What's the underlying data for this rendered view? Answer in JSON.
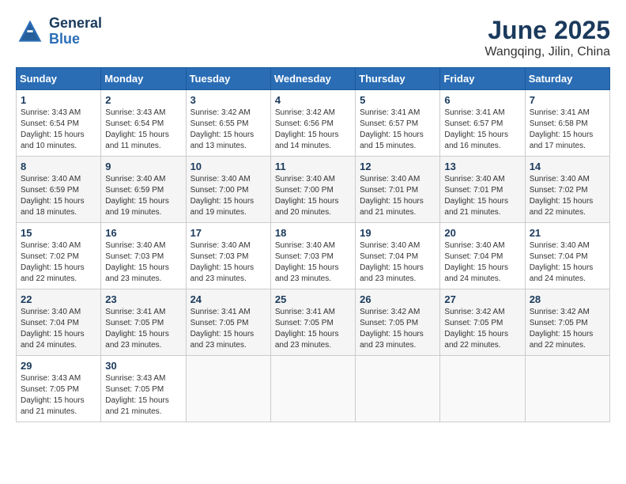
{
  "logo": {
    "line1": "General",
    "line2": "Blue"
  },
  "title": "June 2025",
  "subtitle": "Wangqing, Jilin, China",
  "days_of_week": [
    "Sunday",
    "Monday",
    "Tuesday",
    "Wednesday",
    "Thursday",
    "Friday",
    "Saturday"
  ],
  "weeks": [
    [
      {
        "day": "1",
        "info": "Sunrise: 3:43 AM\nSunset: 6:54 PM\nDaylight: 15 hours\nand 10 minutes."
      },
      {
        "day": "2",
        "info": "Sunrise: 3:43 AM\nSunset: 6:54 PM\nDaylight: 15 hours\nand 11 minutes."
      },
      {
        "day": "3",
        "info": "Sunrise: 3:42 AM\nSunset: 6:55 PM\nDaylight: 15 hours\nand 13 minutes."
      },
      {
        "day": "4",
        "info": "Sunrise: 3:42 AM\nSunset: 6:56 PM\nDaylight: 15 hours\nand 14 minutes."
      },
      {
        "day": "5",
        "info": "Sunrise: 3:41 AM\nSunset: 6:57 PM\nDaylight: 15 hours\nand 15 minutes."
      },
      {
        "day": "6",
        "info": "Sunrise: 3:41 AM\nSunset: 6:57 PM\nDaylight: 15 hours\nand 16 minutes."
      },
      {
        "day": "7",
        "info": "Sunrise: 3:41 AM\nSunset: 6:58 PM\nDaylight: 15 hours\nand 17 minutes."
      }
    ],
    [
      {
        "day": "8",
        "info": "Sunrise: 3:40 AM\nSunset: 6:59 PM\nDaylight: 15 hours\nand 18 minutes."
      },
      {
        "day": "9",
        "info": "Sunrise: 3:40 AM\nSunset: 6:59 PM\nDaylight: 15 hours\nand 19 minutes."
      },
      {
        "day": "10",
        "info": "Sunrise: 3:40 AM\nSunset: 7:00 PM\nDaylight: 15 hours\nand 19 minutes."
      },
      {
        "day": "11",
        "info": "Sunrise: 3:40 AM\nSunset: 7:00 PM\nDaylight: 15 hours\nand 20 minutes."
      },
      {
        "day": "12",
        "info": "Sunrise: 3:40 AM\nSunset: 7:01 PM\nDaylight: 15 hours\nand 21 minutes."
      },
      {
        "day": "13",
        "info": "Sunrise: 3:40 AM\nSunset: 7:01 PM\nDaylight: 15 hours\nand 21 minutes."
      },
      {
        "day": "14",
        "info": "Sunrise: 3:40 AM\nSunset: 7:02 PM\nDaylight: 15 hours\nand 22 minutes."
      }
    ],
    [
      {
        "day": "15",
        "info": "Sunrise: 3:40 AM\nSunset: 7:02 PM\nDaylight: 15 hours\nand 22 minutes."
      },
      {
        "day": "16",
        "info": "Sunrise: 3:40 AM\nSunset: 7:03 PM\nDaylight: 15 hours\nand 23 minutes."
      },
      {
        "day": "17",
        "info": "Sunrise: 3:40 AM\nSunset: 7:03 PM\nDaylight: 15 hours\nand 23 minutes."
      },
      {
        "day": "18",
        "info": "Sunrise: 3:40 AM\nSunset: 7:03 PM\nDaylight: 15 hours\nand 23 minutes."
      },
      {
        "day": "19",
        "info": "Sunrise: 3:40 AM\nSunset: 7:04 PM\nDaylight: 15 hours\nand 23 minutes."
      },
      {
        "day": "20",
        "info": "Sunrise: 3:40 AM\nSunset: 7:04 PM\nDaylight: 15 hours\nand 24 minutes."
      },
      {
        "day": "21",
        "info": "Sunrise: 3:40 AM\nSunset: 7:04 PM\nDaylight: 15 hours\nand 24 minutes."
      }
    ],
    [
      {
        "day": "22",
        "info": "Sunrise: 3:40 AM\nSunset: 7:04 PM\nDaylight: 15 hours\nand 24 minutes."
      },
      {
        "day": "23",
        "info": "Sunrise: 3:41 AM\nSunset: 7:05 PM\nDaylight: 15 hours\nand 23 minutes."
      },
      {
        "day": "24",
        "info": "Sunrise: 3:41 AM\nSunset: 7:05 PM\nDaylight: 15 hours\nand 23 minutes."
      },
      {
        "day": "25",
        "info": "Sunrise: 3:41 AM\nSunset: 7:05 PM\nDaylight: 15 hours\nand 23 minutes."
      },
      {
        "day": "26",
        "info": "Sunrise: 3:42 AM\nSunset: 7:05 PM\nDaylight: 15 hours\nand 23 minutes."
      },
      {
        "day": "27",
        "info": "Sunrise: 3:42 AM\nSunset: 7:05 PM\nDaylight: 15 hours\nand 22 minutes."
      },
      {
        "day": "28",
        "info": "Sunrise: 3:42 AM\nSunset: 7:05 PM\nDaylight: 15 hours\nand 22 minutes."
      }
    ],
    [
      {
        "day": "29",
        "info": "Sunrise: 3:43 AM\nSunset: 7:05 PM\nDaylight: 15 hours\nand 21 minutes."
      },
      {
        "day": "30",
        "info": "Sunrise: 3:43 AM\nSunset: 7:05 PM\nDaylight: 15 hours\nand 21 minutes."
      },
      {
        "day": "",
        "info": ""
      },
      {
        "day": "",
        "info": ""
      },
      {
        "day": "",
        "info": ""
      },
      {
        "day": "",
        "info": ""
      },
      {
        "day": "",
        "info": ""
      }
    ]
  ]
}
